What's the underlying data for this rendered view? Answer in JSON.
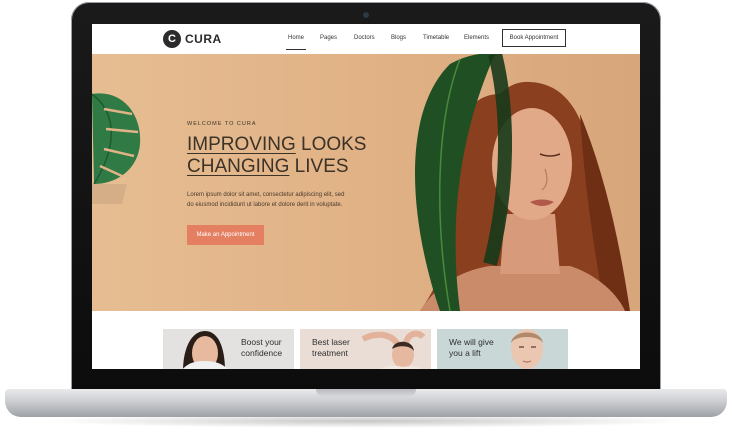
{
  "logo": {
    "mark": "C",
    "text": "CURA"
  },
  "nav": {
    "items": [
      "Home",
      "Pages",
      "Doctors",
      "Blogs",
      "Timetable",
      "Elements"
    ],
    "active": "Home",
    "book_button": "Book Appointment"
  },
  "hero": {
    "eyebrow": "WELCOME TO CURA",
    "headline_line1_u": "IMPROVING",
    "headline_line1_rest": " LOOKS",
    "headline_line2_u": "CHANGING",
    "headline_line2_rest": " LIVES",
    "body_line1": "Lorem ipsum dolor sit amet, consectetur adipiscing elit, sed",
    "body_line2": "do eiusmod incididunt ut labore et dolore derit in voluptate.",
    "cta": "Make an Appointment"
  },
  "cards": [
    {
      "line1": "Boost your",
      "line2": "confidence",
      "bg": "#e4e2e0"
    },
    {
      "line1": "Best laser",
      "line2": "treatment",
      "bg": "#e9ddd6"
    },
    {
      "line1": "We will give",
      "line2": "you a lift",
      "bg": "#c9d8d6"
    }
  ],
  "colors": {
    "accent": "#e47f62",
    "hero_bg": "#e1b387",
    "text_dark": "#3b3228"
  },
  "icons": [
    "laptop-camera",
    "leaf-illustration",
    "woman-portrait"
  ]
}
